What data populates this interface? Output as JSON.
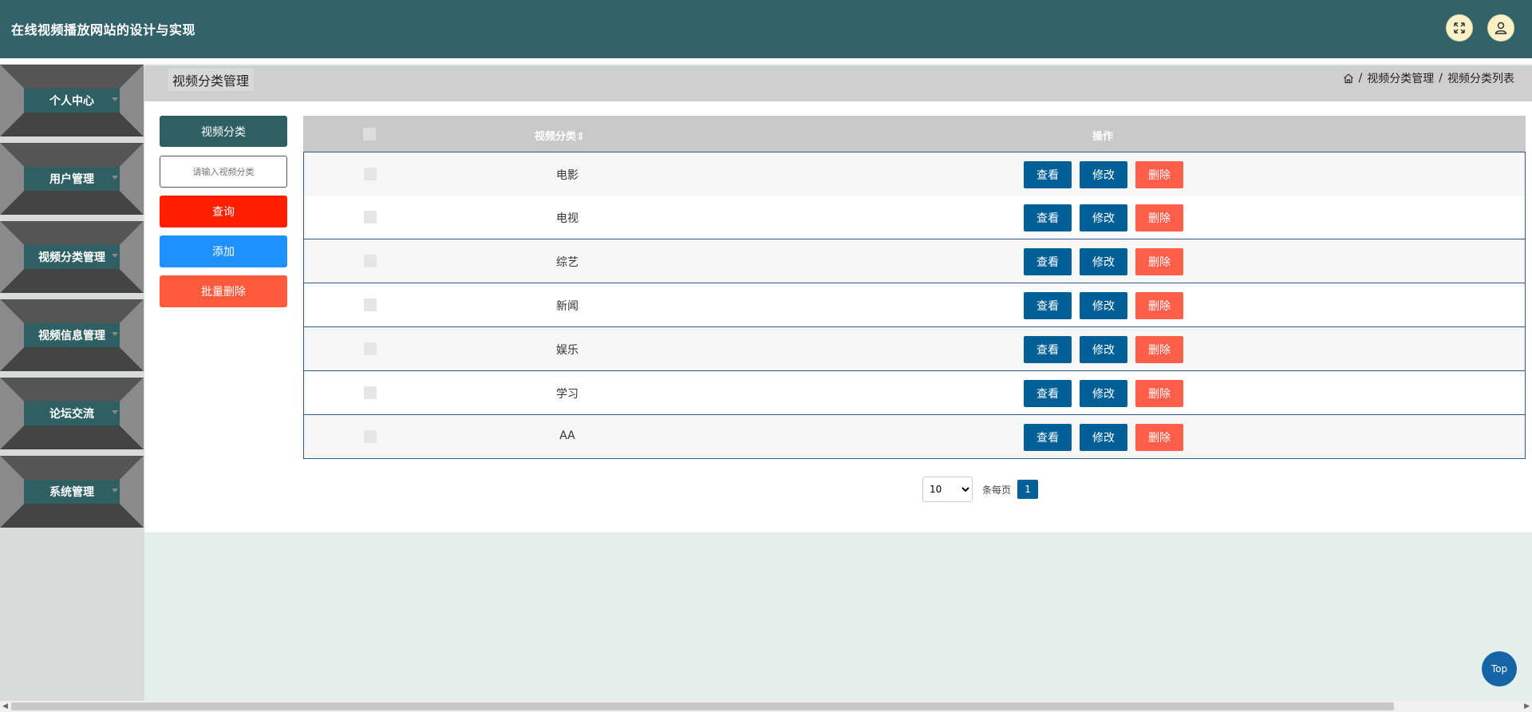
{
  "header": {
    "title": "在线视频播放网站的设计与实现",
    "fullscreen_icon": "fullscreen-icon",
    "user_icon": "user-icon"
  },
  "sidebar": {
    "items": [
      {
        "label": "个人中心"
      },
      {
        "label": "用户管理"
      },
      {
        "label": "视频分类管理"
      },
      {
        "label": "视频信息管理"
      },
      {
        "label": "论坛交流"
      },
      {
        "label": "系统管理"
      }
    ]
  },
  "breadcrumb": {
    "page_title": "视频分类管理",
    "home_icon": "home-icon",
    "sep1": "/",
    "level1": "视频分类管理",
    "sep2": "/",
    "level2": "视频分类列表"
  },
  "filter": {
    "label": "视频分类",
    "placeholder": "请输入视频分类",
    "query_label": "查询",
    "add_label": "添加",
    "batch_delete_label": "批量删除"
  },
  "table": {
    "headers": {
      "name": "视频分类",
      "operations": "操作"
    },
    "rows": [
      {
        "name": "电影"
      },
      {
        "name": "电视"
      },
      {
        "name": "综艺"
      },
      {
        "name": "新闻"
      },
      {
        "name": "娱乐"
      },
      {
        "name": "学习"
      },
      {
        "name": "AA"
      }
    ],
    "view_label": "查看",
    "edit_label": "修改",
    "delete_label": "删除"
  },
  "pagination": {
    "page_size": "10",
    "per_page_label": "条每页",
    "current_page": "1"
  },
  "back_to_top": "Top",
  "colors": {
    "header_bg": "#33636a",
    "menu_label_bg": "#2e5f63",
    "query_btn": "#ff1e00",
    "add_btn": "#1e90ff",
    "batch_delete_btn": "#ff5a3c",
    "view_edit_btn": "#005f96",
    "delete_btn": "#ff5e4a"
  }
}
